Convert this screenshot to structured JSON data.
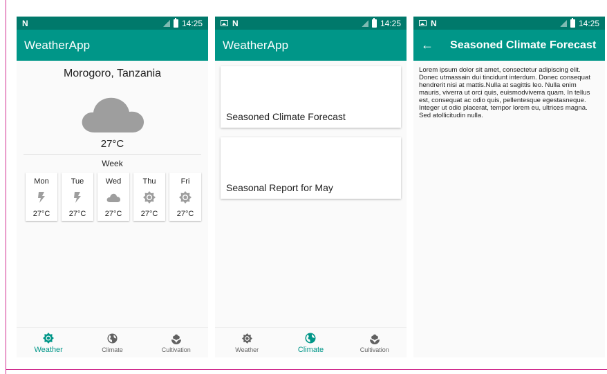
{
  "status": {
    "time": "14:25"
  },
  "app_title": "WeatherApp",
  "weather": {
    "city": "Morogoro, Tanzania",
    "temperature": "27°C",
    "week_label": "Week",
    "days": [
      {
        "name": "Mon",
        "icon": "lightning-icon",
        "temp": "27°C"
      },
      {
        "name": "Tue",
        "icon": "lightning-icon",
        "temp": "27°C"
      },
      {
        "name": "Wed",
        "icon": "cloud-icon",
        "temp": "27°C"
      },
      {
        "name": "Thu",
        "icon": "sun-icon",
        "temp": "27°C"
      },
      {
        "name": "Fri",
        "icon": "sun-icon",
        "temp": "27°C"
      }
    ]
  },
  "nav": {
    "weather_label": "Weather",
    "climate_label": "Climate",
    "cultivation_label": "Cultivation"
  },
  "climate": {
    "cards": [
      {
        "title": "Seasoned Climate Forecast"
      },
      {
        "title": "Seasonal Report for May"
      }
    ]
  },
  "detail": {
    "title": "Seasoned Climate Forecast",
    "body": "Lorem ipsum dolor sit amet, consectetur adipiscing elit. Donec utmassain dui tincidunt interdum. Donec consequat hendrerit nisi at mattis.Nulla at sagittis leo. Nulla enim mauris, viverra ut orci quis, euismodviverra quam. In tellus est, consequat ac odio quis, pellentesque egestasneque. Integer ut odio placerat, tempor lorem eu, ultrices magna. Sed atollicitudin nulla."
  },
  "colors": {
    "status_bar": "#00796b",
    "app_bar": "#009688",
    "accent": "#009688",
    "icon_gray": "#9e9e9e"
  }
}
